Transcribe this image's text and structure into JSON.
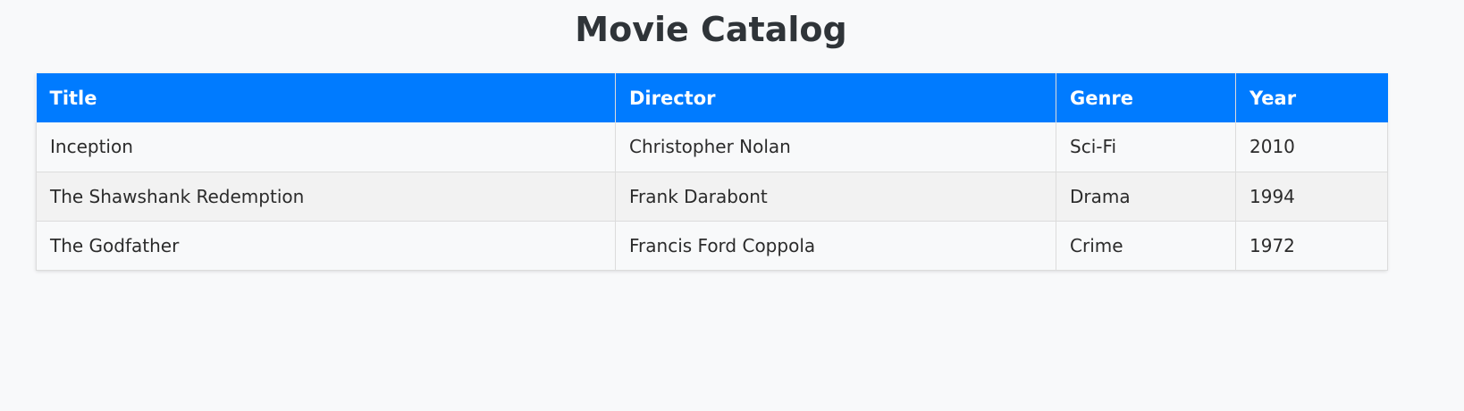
{
  "page": {
    "title": "Movie Catalog"
  },
  "colors": {
    "header_bg": "#007bff",
    "header_text": "#ffffff",
    "page_bg": "#f8f9fa",
    "row_alt_bg": "#f2f2f2"
  },
  "table": {
    "headers": [
      "Title",
      "Director",
      "Genre",
      "Year"
    ],
    "rows": [
      [
        "Inception",
        "Christopher Nolan",
        "Sci-Fi",
        "2010"
      ],
      [
        "The Shawshank Redemption",
        "Frank Darabont",
        "Drama",
        "1994"
      ],
      [
        "The Godfather",
        "Francis Ford Coppola",
        "Crime",
        "1972"
      ]
    ]
  }
}
